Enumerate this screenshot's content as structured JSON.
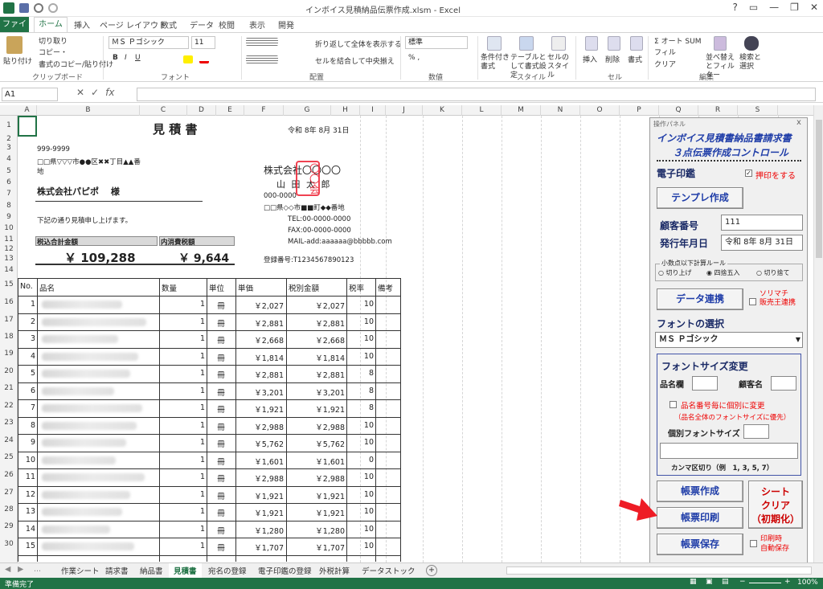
{
  "app": {
    "title": "インボイス見積納品伝票作成.xlsm - Excel"
  },
  "ribbon": {
    "tabs": [
      "ファイル",
      "ホーム",
      "挿入",
      "ページ レイアウト",
      "数式",
      "データ",
      "校閲",
      "表示",
      "開発"
    ],
    "clipboard": {
      "paste": "貼り付け",
      "cut": "切り取り",
      "copy": "コピー・",
      "format_painter": "書式のコピー/貼り付け",
      "label": "クリップボード"
    },
    "font": {
      "name": "ＭＳ Ｐゴシック",
      "size": "11",
      "bold": "B",
      "italic": "I",
      "underline": "U",
      "label": "フォント"
    },
    "alignment": {
      "wrap": "折り返して全体を表示する",
      "merge": "セルを結合して中央揃え",
      "label": "配置"
    },
    "number": {
      "format": "標準",
      "label": "数値"
    },
    "styles": {
      "conditional": "条件付き書式",
      "table": "テーブルとして書式設定",
      "cell": "セルのスタイル",
      "label": "スタイル"
    },
    "cells": {
      "insert": "挿入",
      "delete": "削除",
      "format": "書式",
      "label": "セル"
    },
    "editing": {
      "autosum": "オート SUM",
      "fill": "フィル",
      "clear": "クリア",
      "sort": "並べ替えとフィルター",
      "find": "検索と選択",
      "label": "編集"
    }
  },
  "formula": {
    "namebox": "A1",
    "fx": "fx"
  },
  "columns": [
    "A",
    "B",
    "C",
    "D",
    "E",
    "F",
    "G",
    "H",
    "I",
    "J",
    "K",
    "L",
    "M",
    "N",
    "O",
    "P",
    "Q",
    "R",
    "S"
  ],
  "rows": [
    "1",
    "2",
    "3",
    "4",
    "5",
    "6",
    "7",
    "8",
    "9",
    "10",
    "11",
    "12",
    "13",
    "14",
    "15",
    "16",
    "17",
    "18",
    "19",
    "20",
    "21",
    "22",
    "23",
    "24",
    "25",
    "26",
    "27",
    "28",
    "29",
    "30"
  ],
  "doc": {
    "title": "見 積 書",
    "date": "令和 8年 8月 31日",
    "postal": "999-9999",
    "address1": "□□県▽▽▽市●●区✖✖丁目▲▲番",
    "address2": "地",
    "customer": "株式会社パピポ　 様",
    "greeting": "下記の通り見積申し上げます。",
    "total_label": "税込合計金額",
    "tax_label": "内消費税額",
    "total": "￥ 109,288",
    "tax": "￥ 9,644",
    "company": "株式会社〇〇〇〇",
    "person": "山 田 太 郎",
    "stamp": "〇〇会",
    "co_postal": "000-0000",
    "co_address": "□□県◇◇市■■町◆◆番地",
    "tel": "TEL:00-0000-0000",
    "fax": "FAX:00-0000-0000",
    "mail": "MAIL-add:aaaaaa@bbbbb.com",
    "reg": "登録番号:T1234567890123",
    "headers": [
      "No.",
      "品名",
      "数量",
      "単位",
      "単価",
      "税別金額",
      "税率",
      "備考"
    ],
    "items": [
      {
        "no": "1",
        "qty": "1",
        "unit": "冊",
        "price": "￥2,027",
        "amount": "￥2,027",
        "rate": "10"
      },
      {
        "no": "2",
        "qty": "1",
        "unit": "冊",
        "price": "￥2,881",
        "amount": "￥2,881",
        "rate": "10"
      },
      {
        "no": "3",
        "qty": "1",
        "unit": "冊",
        "price": "￥2,668",
        "amount": "￥2,668",
        "rate": "10"
      },
      {
        "no": "4",
        "qty": "1",
        "unit": "冊",
        "price": "￥1,814",
        "amount": "￥1,814",
        "rate": "10"
      },
      {
        "no": "5",
        "qty": "1",
        "unit": "冊",
        "price": "￥2,881",
        "amount": "￥2,881",
        "rate": "8"
      },
      {
        "no": "6",
        "qty": "1",
        "unit": "冊",
        "price": "￥3,201",
        "amount": "￥3,201",
        "rate": "8"
      },
      {
        "no": "7",
        "qty": "1",
        "unit": "冊",
        "price": "￥1,921",
        "amount": "￥1,921",
        "rate": "8"
      },
      {
        "no": "8",
        "qty": "1",
        "unit": "冊",
        "price": "￥2,988",
        "amount": "￥2,988",
        "rate": "10"
      },
      {
        "no": "9",
        "qty": "1",
        "unit": "冊",
        "price": "￥5,762",
        "amount": "￥5,762",
        "rate": "10"
      },
      {
        "no": "10",
        "qty": "1",
        "unit": "冊",
        "price": "￥1,601",
        "amount": "￥1,601",
        "rate": "0"
      },
      {
        "no": "11",
        "qty": "1",
        "unit": "冊",
        "price": "￥2,988",
        "amount": "￥2,988",
        "rate": "10"
      },
      {
        "no": "12",
        "qty": "1",
        "unit": "冊",
        "price": "￥1,921",
        "amount": "￥1,921",
        "rate": "10"
      },
      {
        "no": "13",
        "qty": "1",
        "unit": "冊",
        "price": "￥1,921",
        "amount": "￥1,921",
        "rate": "10"
      },
      {
        "no": "14",
        "qty": "1",
        "unit": "冊",
        "price": "￥1,280",
        "amount": "￥1,280",
        "rate": "10"
      },
      {
        "no": "15",
        "qty": "1",
        "unit": "冊",
        "price": "￥1,707",
        "amount": "￥1,707",
        "rate": "10"
      }
    ]
  },
  "panel": {
    "caption": "操作パネル",
    "close": "x",
    "title1": "インボイス見積書納品書請求書",
    "title2": "３点伝票作成コントロール",
    "stamp_label": "電子印鑑",
    "stamp_check": "押印をする",
    "template_btn": "テンプレ作成",
    "customer_no_label": "顧客番号",
    "customer_no": "111",
    "issue_date_label": "発行年月日",
    "issue_date": "令和 8年 8月 31日",
    "rounding_label": "小数点以下計算ルール",
    "round_up": "切り上げ",
    "round_half": "四捨五入",
    "round_down": "切り捨て",
    "data_btn": "データ連携",
    "sorimachi": "ソリマチ\n販売王連携",
    "font_select_label": "フォントの選択",
    "font_value": "ＭＳ Ｐゴシック",
    "font_size_label": "フォントサイズ変更",
    "item_col": "品名欄",
    "cust_name": "顧客名",
    "per_item": "品名番号毎に個別に変更",
    "per_item_note": "（品名全体のフォントサイズに優先）",
    "indiv_size": "個別フォントサイズ",
    "comma_note": "カンマ区切り（例　1, 3, 5, 7）",
    "create_btn": "帳票作成",
    "print_btn": "帳票印刷",
    "save_btn": "帳票保存",
    "clear_btn": "シート\nクリア\n（初期化）",
    "auto_save": "印刷時\n自動保存"
  },
  "sheet_tabs": [
    "作業シート",
    "請求書",
    "納品書",
    "見積書",
    "宛名の登録",
    "電子印鑑の登録",
    "外税計算",
    "データストック"
  ],
  "status": {
    "ready": "準備完了",
    "zoom": "100%"
  }
}
